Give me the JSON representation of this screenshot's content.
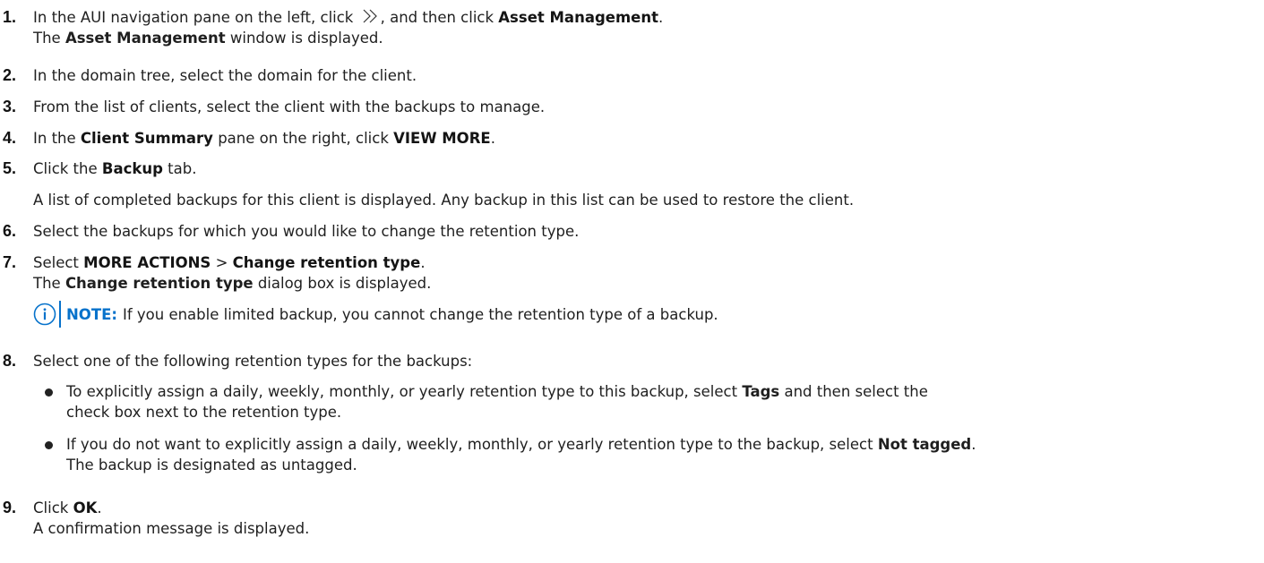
{
  "steps": [
    {
      "num": "1.",
      "pre": "In the AUI navigation pane on the left, click ",
      "mid": ", and then click ",
      "bold": "Asset Management",
      "post": ".",
      "r_bold": "Asset Management",
      "r_post": " window is displayed.",
      "r_pre": "The "
    },
    {
      "num": "2.",
      "text": "In the domain tree, select the domain for the client."
    },
    {
      "num": "3.",
      "text": "From the list of clients, select the client with the backups to manage."
    },
    {
      "num": "4.",
      "pre": "In the ",
      "bold1": "Client Summary",
      "mid": " pane on the right, click ",
      "bold2": "VIEW MORE",
      "post": "."
    },
    {
      "num": "5.",
      "pre": "Click the ",
      "bold": "Backup",
      "post": " tab.",
      "result": "A list of completed backups for this client is displayed. Any backup in this list can be used to restore the client."
    },
    {
      "num": "6.",
      "text": "Select the backups for which you would like to change the retention type."
    },
    {
      "num": "7.",
      "pre": "Select ",
      "bold1": "MORE ACTIONS",
      "mid": " > ",
      "bold2": "Change retention type",
      "post": ".",
      "r_pre": "The ",
      "r_bold": "Change retention type",
      "r_post": " dialog box is displayed."
    },
    {
      "num": "8.",
      "text": "Select one of the following retention types for the backups:"
    },
    {
      "num": "9.",
      "pre": "Click ",
      "bold": "OK",
      "post": ".",
      "result": "A confirmation message is displayed."
    }
  ],
  "note": {
    "icon": "info-circle-icon",
    "label": "NOTE:",
    "text": " If you enable limited backup, you cannot change the retention type of a backup.",
    "color": "#0672cb"
  },
  "bullets": [
    {
      "l1_pre": "To explicitly assign a daily, weekly, monthly, or yearly retention type to this backup, select ",
      "l1_bold": "Tags",
      "l1_post": " and then select the",
      "l2": "check box next to the retention type."
    },
    {
      "l1_pre": "If you do not want to explicitly assign a daily, weekly, monthly, or yearly retention type to the backup, select ",
      "l1_bold": "Not tagged",
      "l1_post": ".",
      "l2": "The backup is designated as untagged."
    }
  ],
  "nav_icon": "double-chevron-right-icon"
}
